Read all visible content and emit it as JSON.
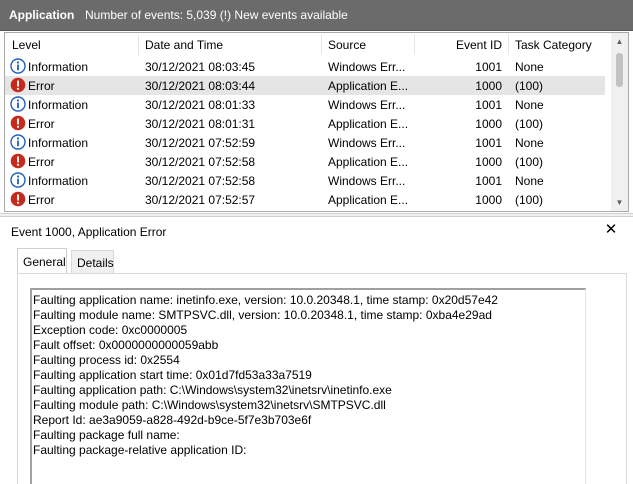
{
  "header": {
    "title": "Application",
    "status": "Number of events: 5,039 (!) New events available"
  },
  "columns": {
    "level": "Level",
    "date": "Date and Time",
    "source": "Source",
    "event_id": "Event ID",
    "category": "Task Category"
  },
  "events": [
    {
      "level": "Information",
      "icon": "info-icon",
      "date": "30/12/2021 08:03:45",
      "source": "Windows Err...",
      "id": "1001",
      "category": "None"
    },
    {
      "level": "Error",
      "icon": "error-icon",
      "date": "30/12/2021 08:03:44",
      "source": "Application E...",
      "id": "1000",
      "category": "(100)"
    },
    {
      "level": "Information",
      "icon": "info-icon",
      "date": "30/12/2021 08:01:33",
      "source": "Windows Err...",
      "id": "1001",
      "category": "None"
    },
    {
      "level": "Error",
      "icon": "error-icon",
      "date": "30/12/2021 08:01:31",
      "source": "Application E...",
      "id": "1000",
      "category": "(100)"
    },
    {
      "level": "Information",
      "icon": "info-icon",
      "date": "30/12/2021 07:52:59",
      "source": "Windows Err...",
      "id": "1001",
      "category": "None"
    },
    {
      "level": "Error",
      "icon": "error-icon",
      "date": "30/12/2021 07:52:58",
      "source": "Application E...",
      "id": "1000",
      "category": "(100)"
    },
    {
      "level": "Information",
      "icon": "info-icon",
      "date": "30/12/2021 07:52:58",
      "source": "Windows Err...",
      "id": "1001",
      "category": "None"
    },
    {
      "level": "Error",
      "icon": "error-icon",
      "date": "30/12/2021 07:52:57",
      "source": "Application E...",
      "id": "1000",
      "category": "(100)"
    }
  ],
  "selected_row": 1,
  "detail": {
    "title": "Event 1000, Application Error",
    "close_icon": "close-icon",
    "tabs": [
      "General",
      "Details"
    ],
    "active_tab": "General",
    "description_lines": [
      "Faulting application name: inetinfo.exe, version: 10.0.20348.1, time stamp: 0x20d57e42",
      "Faulting module name: SMTPSVC.dll, version: 10.0.20348.1, time stamp: 0xba4e29ad",
      "Exception code: 0xc0000005",
      "Fault offset: 0x0000000000059abb",
      "Faulting process id: 0x2554",
      "Faulting application start time: 0x01d7fd53a33a7519",
      "Faulting application path: C:\\Windows\\system32\\inetsrv\\inetinfo.exe",
      "Faulting module path: C:\\Windows\\system32\\inetsrv\\SMTPSVC.dll",
      "Report Id: ae3a9059-a828-492d-b9ce-5f7e3b703e6f",
      "Faulting package full name:",
      "Faulting package-relative application ID:"
    ]
  },
  "colors": {
    "header_bg": "#6b6b6b",
    "info_blue": "#1f5fbf",
    "error_red": "#c42b1c",
    "selected_row": "#e5e5e5"
  }
}
